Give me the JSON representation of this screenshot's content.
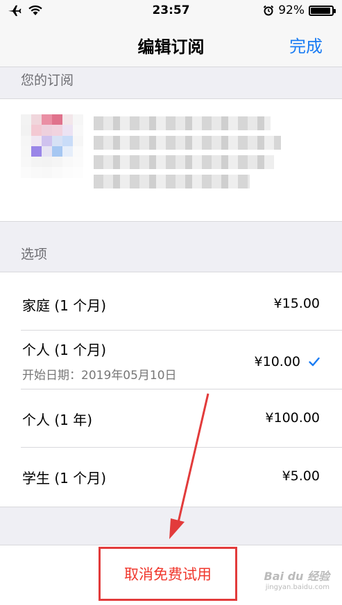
{
  "status_bar": {
    "time": "23:57",
    "battery_percent_label": "92%",
    "battery_level": 0.92,
    "icons": [
      "airplane-icon",
      "wifi-icon",
      "alarm-icon",
      "battery-icon"
    ]
  },
  "nav": {
    "title": "编辑订阅",
    "done_label": "完成"
  },
  "subscription_section": {
    "header": "您的订阅"
  },
  "options_section": {
    "header": "选项",
    "items": [
      {
        "label": "家庭 (1 个月)",
        "price": "¥15.00"
      },
      {
        "label": "个人 (1 个月)",
        "subtitle": "开始日期：2019年05月10日",
        "price": "¥10.00",
        "selected": true
      },
      {
        "label": "个人 (1 年)",
        "price": "¥100.00"
      },
      {
        "label": "学生 (1 个月)",
        "price": "¥5.00"
      }
    ]
  },
  "cancel": {
    "label": "取消免费试用"
  },
  "colors": {
    "accent": "#1a7cf3",
    "destructive": "#f0372c",
    "annotation": "#e23b3b"
  },
  "watermark": {
    "main": "Bai du 经验",
    "sub": "jingyan.baidu.com"
  }
}
